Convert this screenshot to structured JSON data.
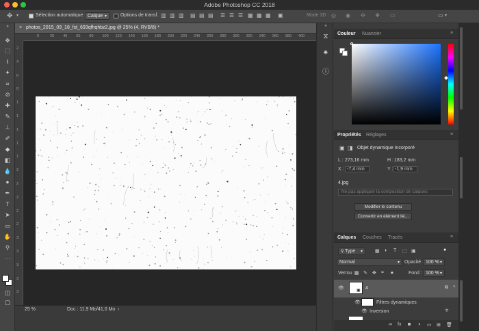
{
  "app": {
    "title": "Adobe Photoshop CC 2018"
  },
  "options": {
    "auto_select_label": "Sélection automatique :",
    "auto_select_value": "Calque",
    "transform_label": "Options de transf.",
    "mode3d_label": "Mode 3D :"
  },
  "document": {
    "tab_title": "photos_2015_09_18_fst_693qfhqhbz2.jpg @ 25% (4, RVB/8) *",
    "ruler_h": [
      "0",
      "20",
      "40",
      "60",
      "80",
      "100",
      "120",
      "140",
      "160",
      "180",
      "200",
      "220",
      "240",
      "260",
      "280",
      "300",
      "320",
      "340",
      "360",
      "380",
      "400"
    ],
    "ruler_v": [
      "2",
      "4",
      "6",
      "8",
      "1",
      "1",
      "1",
      "1",
      "1",
      "2",
      "2",
      "2",
      "2",
      "2",
      "3",
      "3",
      "3",
      "3",
      "3"
    ],
    "zoom": "25 %",
    "doc_info": "Doc : 11,9 Mo/41,0 Mo"
  },
  "colors": {
    "canvas_bg": "#262626",
    "accent": "#1a73ff"
  },
  "color_panel": {
    "tabs": [
      "Couleur",
      "Nuancier"
    ]
  },
  "props_panel": {
    "tabs": [
      "Propriétés",
      "Réglages"
    ],
    "title": "Objet dynamique incorporé",
    "L_label": "L :",
    "L": "273,16 mm",
    "H_label": "H :",
    "H": "183,2 mm",
    "X_label": "X :",
    "X": "-7,4 mm",
    "Y_label": "Y :",
    "Y": "-1,9 mm",
    "filename": "4.jpg",
    "comp_placeholder": "Ne pas appliquer la composition de calques",
    "edit_button": "Modifier le contenu",
    "convert_button": "Convertir en élément lié..."
  },
  "layers_panel": {
    "tabs": [
      "Calques",
      "Couches",
      "Tracés"
    ],
    "filter": "Type",
    "blend_mode": "Normal",
    "opacity_label": "Opacité :",
    "opacity": "100 %",
    "lock_label": "Verrou :",
    "fill_label": "Fond :",
    "fill": "100 %",
    "layers": [
      {
        "name": "4"
      },
      {
        "name": "Filtres dynamiques"
      },
      {
        "name": "Inversion"
      }
    ]
  }
}
